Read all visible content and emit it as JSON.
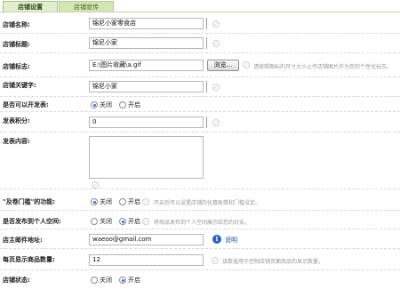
{
  "tabs": [
    {
      "label": "店铺设置"
    },
    {
      "label": "店铺宣传"
    }
  ],
  "form": {
    "shop_name": {
      "label": "店铺名称:",
      "value": "锦尼小家零食店"
    },
    "shop_title": {
      "label": "店铺标题:",
      "value": "锦尼小家"
    },
    "shop_logo": {
      "label": "店铺标志:",
      "value": "E:\\图片收藏\\a.gif",
      "browse": "浏览...",
      "hint": "请按照图标的尺寸大小上传店铺图片作为您的个性化标志。"
    },
    "shop_keywords": {
      "label": "店铺关键字:",
      "value": "锦尼小家"
    },
    "allow_post": {
      "label": "是否可以开发表:",
      "options": [
        "关闭",
        "开启"
      ],
      "selected": 0
    },
    "post_points": {
      "label": "发表积分:",
      "value": "0"
    },
    "post_content": {
      "label": "发表内容:",
      "value": ""
    },
    "feature": {
      "label": "\"及卷门槛\"的功能:",
      "options": [
        "关闭",
        "开启"
      ],
      "selected": 0,
      "hint": "开启后可以设置店铺的优惠政策和门槛设定。"
    },
    "personal_space": {
      "label": "是否发布到个人空间:",
      "options": [
        "关闭",
        "开启"
      ],
      "selected": 1,
      "hint": "将商品发布到个人空间展示给您的好友。"
    },
    "owner_email": {
      "label": "店主邮件地址:",
      "value": "waeoo@gmail.com",
      "info_label": "说明"
    },
    "items_per_page": {
      "label": "每页显示商品数量:",
      "value": "12",
      "hint": "该数值用于控制店铺页面商品的显示数量。"
    },
    "shop_status": {
      "label": "店铺状态:",
      "options": [
        "关闭",
        "开启"
      ],
      "selected": 1
    }
  }
}
